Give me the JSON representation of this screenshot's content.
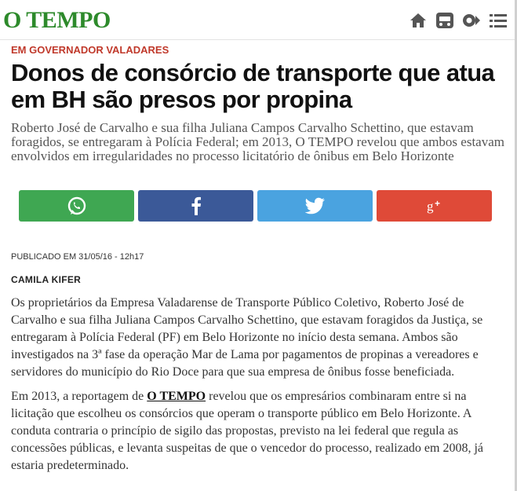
{
  "header": {
    "logo": "O TEMPO",
    "icons": [
      "home-icon",
      "car-icon",
      "gallery-icon",
      "menu-icon"
    ],
    "accent": "#2d8a2b"
  },
  "article": {
    "section": "EM GOVERNADOR VALADARES",
    "title": "Donos de consórcio de transporte que atua em BH são presos por propina",
    "lead": "Roberto José de Carvalho e sua filha Juliana Campos Carvalho Schettino, que estavam foragidos, se entregaram à Polícia Federal; em 2013, O TEMPO revelou que ambos estavam envolvidos em irregularidades no processo licitatório de ônibus em Belo Horizonte",
    "published": "PUBLICADO EM 31/05/16 - 12h17",
    "author": "CAMILA KIFER",
    "paragraph1": "Os proprietários da Empresa Valadarense de Transporte Público Coletivo, Roberto José de Carvalho e sua filha Juliana Campos Carvalho Schettino, que estavam foragidos da Justiça, se entregaram à Polícia Federal (PF) em Belo Horizonte no início desta semana. Ambos são investigados na 3ª fase da operação Mar de Lama por pagamentos de propinas a vereadores e servidores do município do Rio Doce para que sua empresa de ônibus fosse beneficiada.",
    "paragraph2_start": "Em 2013, a reportagem de ",
    "paragraph2_link": "O TEMPO",
    "paragraph2_end": " revelou que os empresários combinaram entre si na licitação que escolheu os consórcios que operam o transporte público em Belo Horizonte. A conduta contraria o princípio de sigilo das propostas, previsto na lei federal que regula as concessões públicas, e levanta suspeitas de que o vencedor do processo, realizado em 2008, já estaria predeterminado."
  },
  "share": {
    "buttons": [
      {
        "name": "whatsapp-share-button",
        "icon": "whatsapp-icon",
        "color": "#3fa752"
      },
      {
        "name": "facebook-share-button",
        "icon": "facebook-icon",
        "color": "#3b5998"
      },
      {
        "name": "twitter-share-button",
        "icon": "twitter-icon",
        "color": "#4aa3e0"
      },
      {
        "name": "googleplus-share-button",
        "icon": "googleplus-icon",
        "color": "#df4a38"
      }
    ]
  },
  "colors": {
    "section": "#c0392b"
  }
}
